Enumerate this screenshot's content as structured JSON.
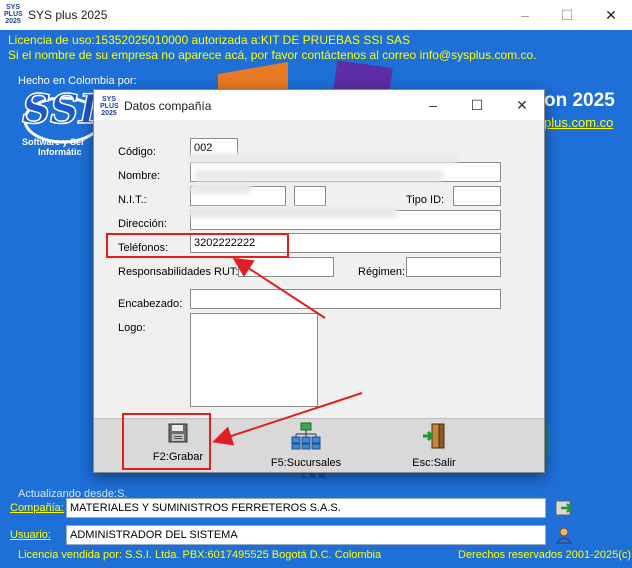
{
  "main_window": {
    "title": "SYS plus 2025",
    "logo_text": [
      "SYS",
      "PLUS",
      "2025"
    ],
    "license_line": "Licencia de uso:15352025010000 autorizada a:KIT DE PRUEBAS SSI SAS",
    "company_hint": "Si el nombre de su empresa no aparece acá, por favor contáctenos al correo info@sysplus.com.co.",
    "made_in": "Hecho en Colombia por:",
    "ssi_logo_text": "SSI",
    "ssi_subtitle_1": "Software y Ser",
    "ssi_subtitle_2": "Informátic",
    "brand_year": "on 2025",
    "brand_site": "plus.com.co",
    "updating_from": "Actualizando desde:S.",
    "company_label": "Compañía:",
    "company_value": "MATERIALES Y SUMINISTROS FERRETEROS S.A.S.",
    "user_label": "Usuario:",
    "user_value": "ADMINISTRADOR DEL SISTEMA",
    "crm_label": "C. R. M.",
    "footer_left": "Licencia vendida por: S.S.I. Ltda. PBX:6017495525 Bogotá D.C. Colombia",
    "footer_right": "Derechos reservados 2001-2025(c)"
  },
  "dialog": {
    "title": "Datos compañía",
    "fields": {
      "codigo_label": "Código:",
      "codigo_value": "002",
      "nombre_label": "Nombre:",
      "nit_label": "N.I.T.:",
      "tipo_id_label": "Tipo ID:",
      "direccion_label": "Dirección:",
      "telefonos_label": "Teléfonos:",
      "telefonos_value": "3202222222",
      "responsabilidades_label": "Responsabilidades RUT:",
      "regimen_label": "Régimen:",
      "encabezado_label": "Encabezado:",
      "logo_label": "Logo:"
    },
    "toolbar": {
      "grabar_label": "F2:Grabar",
      "sucursales_label": "F5:Sucursales",
      "salir_label": "Esc:Salir"
    }
  },
  "colors": {
    "background": "#1e6fd8",
    "license_text": "#ffff00",
    "annotation": "#e02020"
  }
}
